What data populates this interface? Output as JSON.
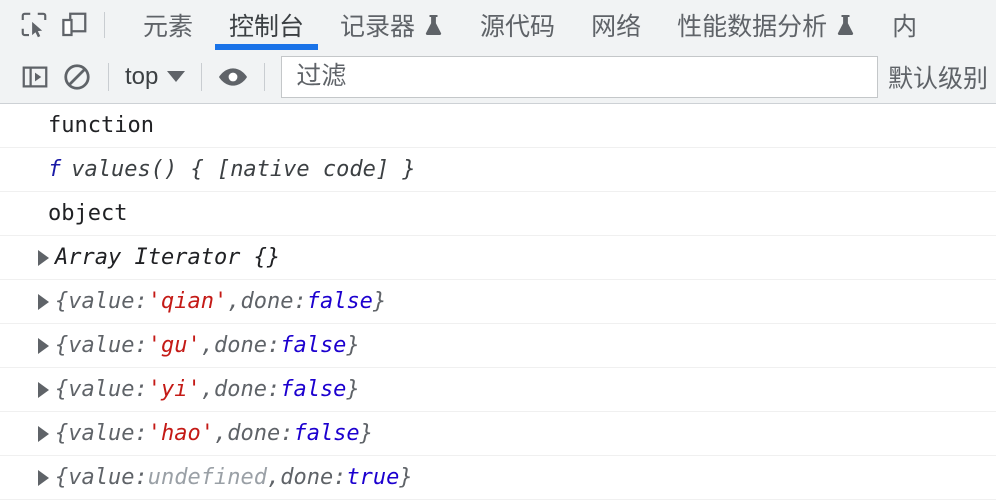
{
  "tabbar": {
    "inspect_icon": "inspect-element-icon",
    "device_icon": "device-toolbar-icon",
    "tabs": [
      {
        "label": "元素",
        "active": false,
        "flask": false
      },
      {
        "label": "控制台",
        "active": true,
        "flask": false
      },
      {
        "label": "记录器",
        "active": false,
        "flask": true
      },
      {
        "label": "源代码",
        "active": false,
        "flask": false
      },
      {
        "label": "网络",
        "active": false,
        "flask": false
      },
      {
        "label": "性能数据分析",
        "active": false,
        "flask": true
      },
      {
        "label": "内",
        "active": false,
        "flask": false
      }
    ],
    "active_underline_color": "#1a73e8"
  },
  "console_toolbar": {
    "sidebar_toggle_icon": "console-sidebar-icon",
    "clear_icon": "clear-console-icon",
    "context_label": "top",
    "eye_icon": "live-expression-eye-icon",
    "filter_placeholder": "过滤",
    "filter_value": "",
    "levels_label": "默认级别"
  },
  "console": {
    "rows": [
      {
        "kind": "text",
        "text": "function"
      },
      {
        "kind": "function",
        "mark": "f",
        "body": "values() { [native code] }"
      },
      {
        "kind": "text",
        "text": "object"
      },
      {
        "kind": "object",
        "name": "Array Iterator {}"
      },
      {
        "kind": "iterresult",
        "open": "{",
        "key1": "value: ",
        "value": "'qian'",
        "value_type": "string",
        "comma": ", ",
        "key2": "done: ",
        "done": "false",
        "close": "}"
      },
      {
        "kind": "iterresult",
        "open": "{",
        "key1": "value: ",
        "value": "'gu'",
        "value_type": "string",
        "comma": ", ",
        "key2": "done: ",
        "done": "false",
        "close": "}"
      },
      {
        "kind": "iterresult",
        "open": "{",
        "key1": "value: ",
        "value": "'yi'",
        "value_type": "string",
        "comma": ", ",
        "key2": "done: ",
        "done": "false",
        "close": "}"
      },
      {
        "kind": "iterresult",
        "open": "{",
        "key1": "value: ",
        "value": "'hao'",
        "value_type": "string",
        "comma": ", ",
        "key2": "done: ",
        "done": "false",
        "close": "}"
      },
      {
        "kind": "iterresult",
        "open": "{",
        "key1": "value: ",
        "value": "undefined",
        "value_type": "undefined",
        "comma": ", ",
        "key2": "done: ",
        "done": "true",
        "close": "}"
      }
    ]
  },
  "colors": {
    "string": "#c41a16",
    "boolean": "#1c00cf",
    "undefined": "#9aa0a6",
    "accent": "#1a73e8",
    "toolbar_bg": "#f1f3f4"
  }
}
